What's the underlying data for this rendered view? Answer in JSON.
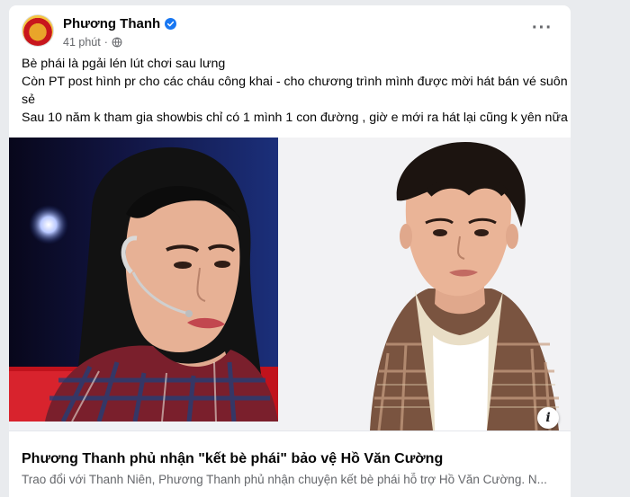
{
  "post": {
    "author": "Phương Thanh",
    "time": "41 phút",
    "more_label": "···",
    "text_lines": [
      "Bè phái là pgải lén lút chơi sau lưng",
      "Còn PT post hình pr cho các cháu công khai - cho chương trình mình được mời hát bán vé suôn",
      "sẻ",
      "Sau 10 năm k tham gia showbis chỉ có 1 mình 1 con đường , giờ e mới ra hát lại cũng k yên nữa"
    ]
  },
  "link": {
    "info_label": "i",
    "title": "Phương Thanh phủ nhận \"kết bè phái\" bảo vệ Hồ Văn Cường",
    "description": "Trao đổi với Thanh Niên, Phương Thanh phủ nhận chuyện kết bè phái hỗ trợ Hồ Văn Cường. N..."
  },
  "colors": {
    "accent": "#1877f2",
    "secondary_text": "#65676b",
    "background": "#e9ebee"
  }
}
